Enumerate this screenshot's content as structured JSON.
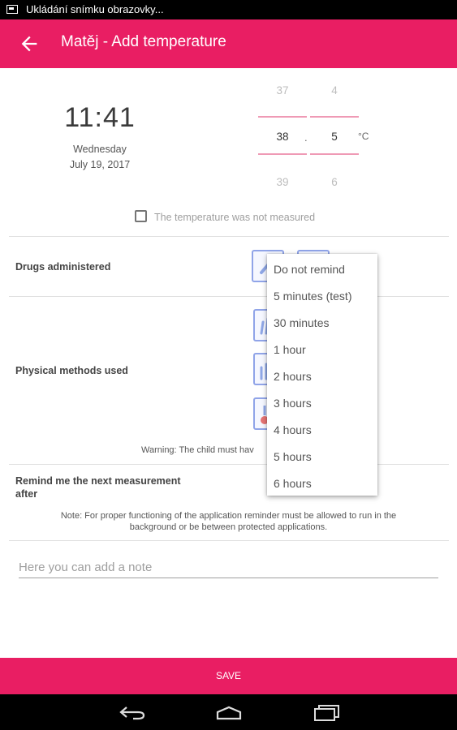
{
  "status_bar": {
    "text": "Ukládání snímku obrazovky..."
  },
  "app_bar": {
    "title": "Matěj - Add temperature"
  },
  "datetime": {
    "time": "11:41",
    "weekday": "Wednesday",
    "date": "July 19, 2017"
  },
  "temperature_picker": {
    "integer": {
      "above": "37",
      "selected": "38",
      "below": "39"
    },
    "decimal": {
      "above": "4",
      "selected": "5",
      "below": "6"
    },
    "separator": ".",
    "unit": "°C"
  },
  "not_measured": {
    "label": "The temperature was not measured",
    "checked": false
  },
  "drugs": {
    "label": "Drugs administered"
  },
  "physical": {
    "label": "Physical methods used",
    "warning": "Warning: The child must hav"
  },
  "reminder": {
    "label_line1": "Remind me the next measurement",
    "label_line2": "after",
    "note_line1": "Note: For proper functioning of the application reminder must be allowed to run in the",
    "note_line2": "background or be between protected applications."
  },
  "note_input": {
    "placeholder": "Here you can add a note",
    "value": ""
  },
  "save": {
    "label": "SAVE"
  },
  "reminder_dropdown": {
    "options": [
      "Do not remind",
      "5 minutes (test)",
      "30 minutes",
      "1 hour",
      "2 hours",
      "3 hours",
      "4 hours",
      "5 hours",
      "6 hours"
    ]
  },
  "colors": {
    "accent": "#e91e63",
    "picker_line": "#ef9ab5",
    "icon_border": "#90a4e8"
  },
  "icons": {
    "back": "arrow-left-icon",
    "screenshot": "image-icon",
    "nav": [
      "back-nav-icon",
      "home-nav-icon",
      "recents-nav-icon"
    ]
  }
}
